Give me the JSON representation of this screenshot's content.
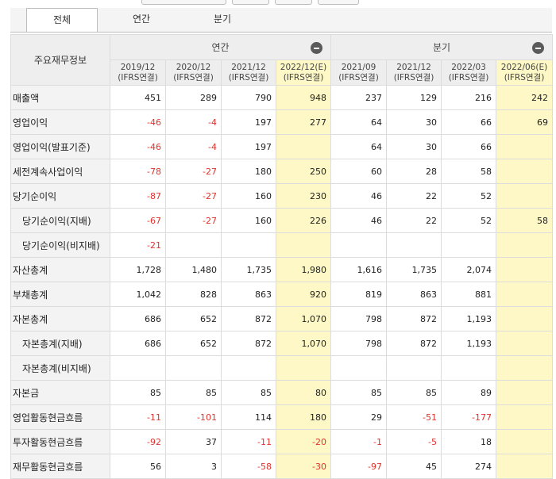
{
  "tabs": [
    {
      "label": "전체",
      "active": true
    },
    {
      "label": "연간",
      "active": false
    },
    {
      "label": "분기",
      "active": false
    }
  ],
  "table": {
    "corner_label": "주요재무정보",
    "groups": [
      {
        "label": "연간"
      },
      {
        "label": "분기"
      }
    ],
    "periods": [
      {
        "date": "2019/12",
        "basis": "(IFRS연결)",
        "estimate": false
      },
      {
        "date": "2020/12",
        "basis": "(IFRS연결)",
        "estimate": false
      },
      {
        "date": "2021/12",
        "basis": "(IFRS연결)",
        "estimate": false
      },
      {
        "date": "2022/12(E)",
        "basis": "(IFRS연결)",
        "estimate": true
      },
      {
        "date": "2021/09",
        "basis": "(IFRS연결)",
        "estimate": false
      },
      {
        "date": "2021/12",
        "basis": "(IFRS연결)",
        "estimate": false
      },
      {
        "date": "2022/03",
        "basis": "(IFRS연결)",
        "estimate": false
      },
      {
        "date": "2022/06(E)",
        "basis": "(IFRS연결)",
        "estimate": true
      }
    ],
    "rows": [
      {
        "label": "매출액",
        "sub": false,
        "values": [
          "451",
          "289",
          "790",
          "948",
          "237",
          "129",
          "216",
          "242"
        ]
      },
      {
        "label": "영업이익",
        "sub": false,
        "values": [
          "-46",
          "-4",
          "197",
          "277",
          "64",
          "30",
          "66",
          "69"
        ]
      },
      {
        "label": "영업이익(발표기준)",
        "sub": false,
        "values": [
          "-46",
          "-4",
          "197",
          "",
          "64",
          "30",
          "66",
          ""
        ]
      },
      {
        "label": "세전계속사업이익",
        "sub": false,
        "values": [
          "-78",
          "-27",
          "180",
          "250",
          "60",
          "28",
          "58",
          ""
        ]
      },
      {
        "label": "당기순이익",
        "sub": false,
        "values": [
          "-87",
          "-27",
          "160",
          "230",
          "46",
          "22",
          "52",
          ""
        ]
      },
      {
        "label": "당기순이익(지배)",
        "sub": true,
        "values": [
          "-67",
          "-27",
          "160",
          "226",
          "46",
          "22",
          "52",
          "58"
        ]
      },
      {
        "label": "당기순이익(비지배)",
        "sub": true,
        "values": [
          "-21",
          "",
          "",
          "",
          "",
          "",
          "",
          ""
        ]
      },
      {
        "label": "자산총계",
        "sub": false,
        "values": [
          "1,728",
          "1,480",
          "1,735",
          "1,980",
          "1,616",
          "1,735",
          "2,074",
          ""
        ]
      },
      {
        "label": "부채총계",
        "sub": false,
        "values": [
          "1,042",
          "828",
          "863",
          "920",
          "819",
          "863",
          "881",
          ""
        ]
      },
      {
        "label": "자본총계",
        "sub": false,
        "values": [
          "686",
          "652",
          "872",
          "1,070",
          "798",
          "872",
          "1,193",
          ""
        ]
      },
      {
        "label": "자본총계(지배)",
        "sub": true,
        "values": [
          "686",
          "652",
          "872",
          "1,070",
          "798",
          "872",
          "1,193",
          ""
        ]
      },
      {
        "label": "자본총계(비지배)",
        "sub": true,
        "values": [
          "",
          "",
          "",
          "",
          "",
          "",
          "",
          ""
        ]
      },
      {
        "label": "자본금",
        "sub": false,
        "values": [
          "85",
          "85",
          "85",
          "80",
          "85",
          "85",
          "89",
          ""
        ]
      },
      {
        "label": "영업활동현금흐름",
        "sub": false,
        "values": [
          "-11",
          "-101",
          "114",
          "180",
          "29",
          "-51",
          "-177",
          ""
        ]
      },
      {
        "label": "투자활동현금흐름",
        "sub": false,
        "values": [
          "-92",
          "37",
          "-11",
          "-20",
          "-1",
          "-5",
          "18",
          ""
        ]
      },
      {
        "label": "재무활동현금흐름",
        "sub": false,
        "values": [
          "56",
          "3",
          "-58",
          "-30",
          "-97",
          "45",
          "274",
          ""
        ]
      }
    ]
  },
  "colors": {
    "negative": "#e0322c",
    "estimate_bg": "#fdf8c6",
    "header_bg": "#eeeeee"
  }
}
